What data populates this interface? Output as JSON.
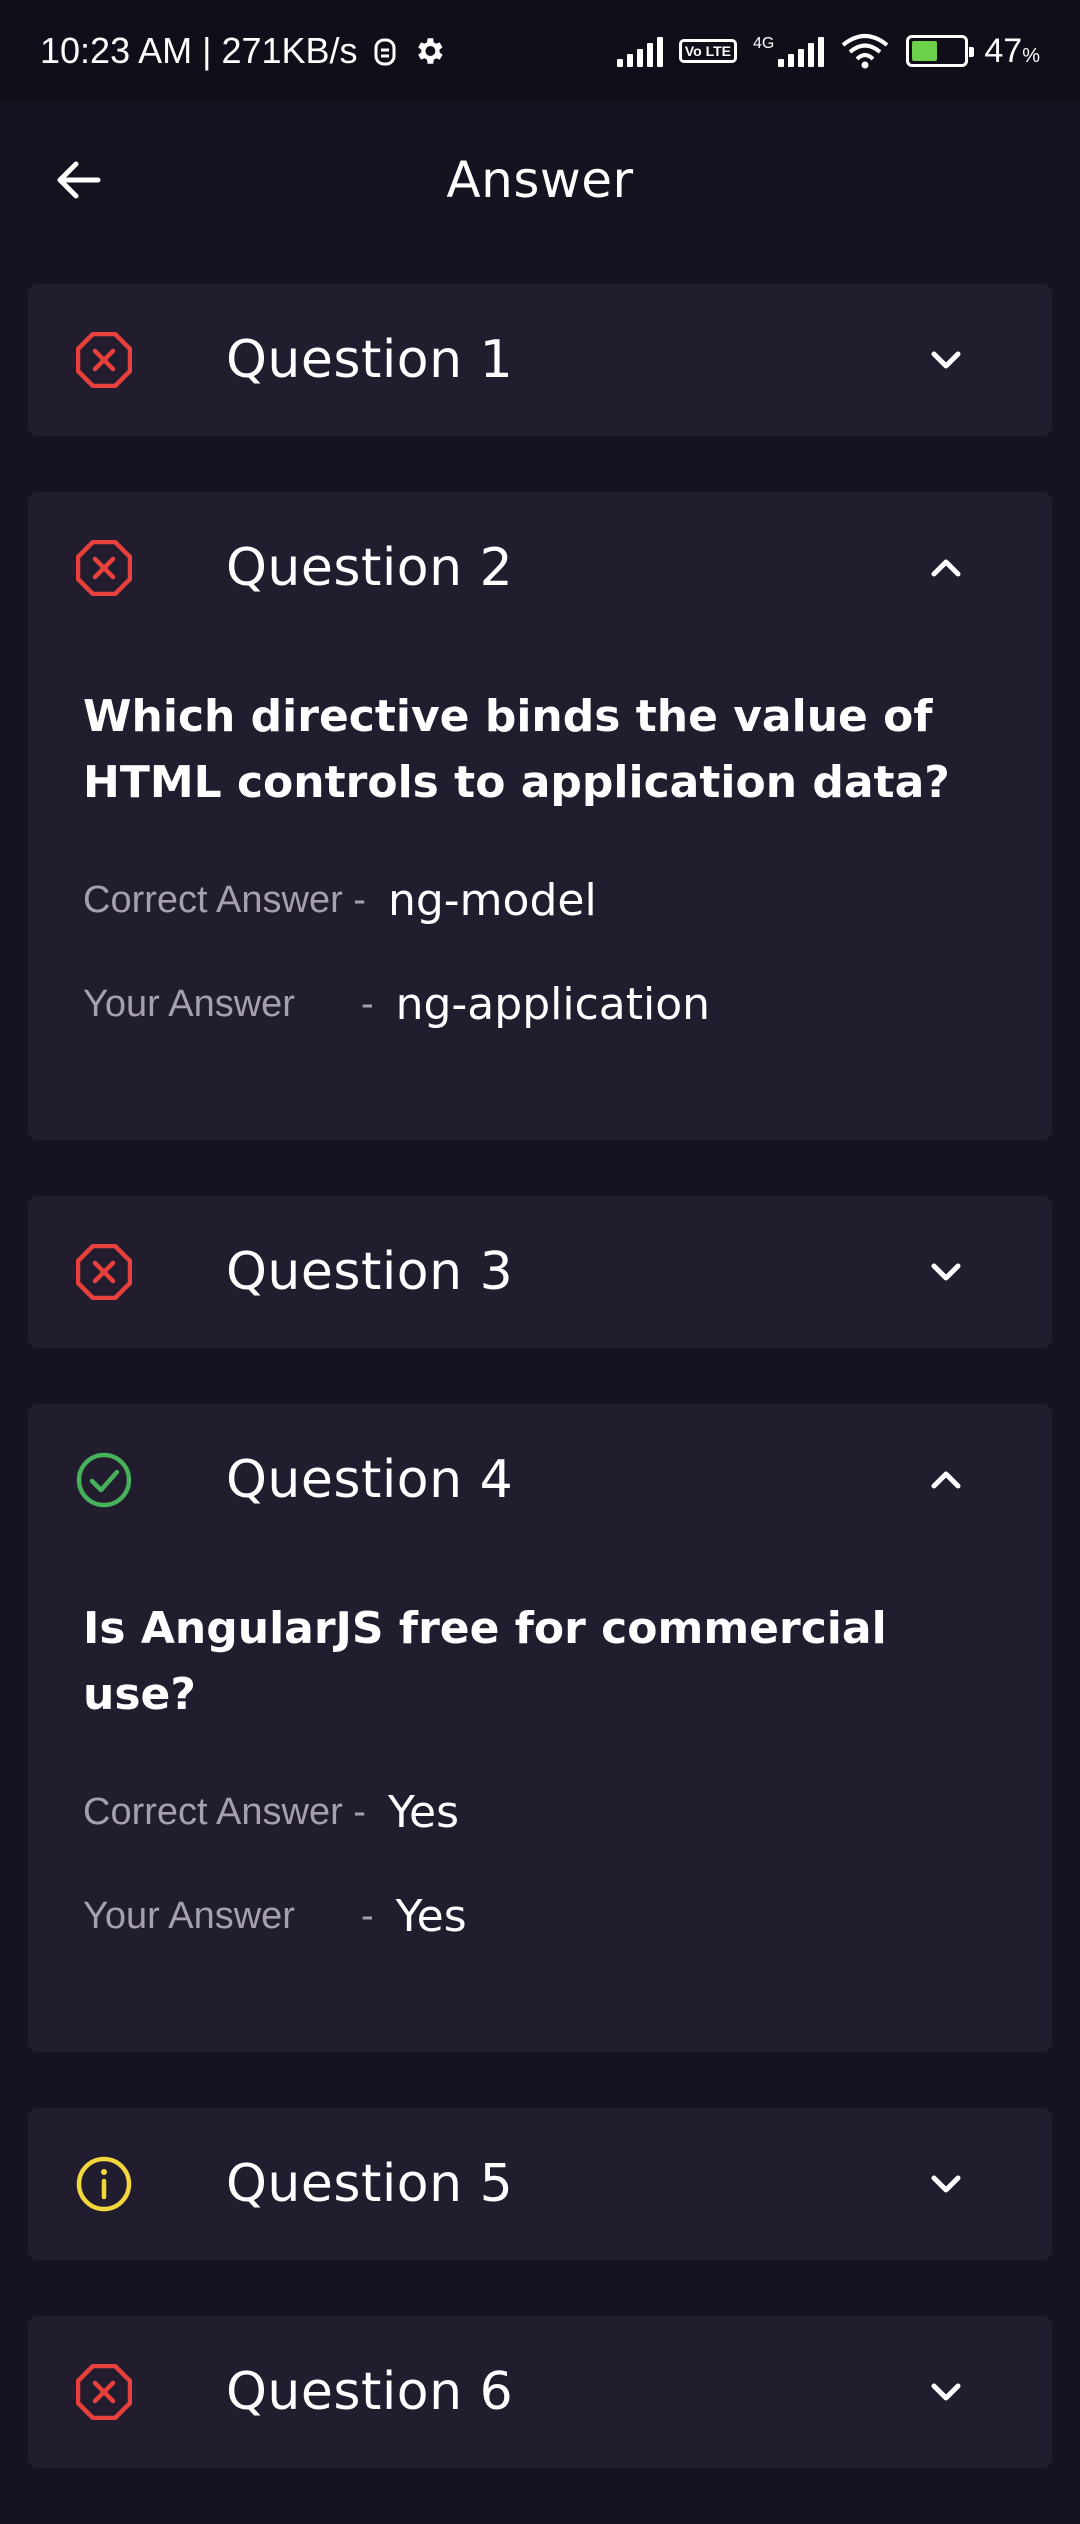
{
  "status_bar": {
    "time_speed": "10:23 AM | 271KB/s",
    "volte": "Vo LTE",
    "network": "4G",
    "battery_percent": "47",
    "battery_unit": "%",
    "battery_level": 0.47
  },
  "app_bar": {
    "title": "Answer"
  },
  "labels": {
    "correct_answer": "Correct Answer -",
    "your_answer": "Your Answer",
    "dash": "-"
  },
  "questions": [
    {
      "label": "Question 1",
      "status": "wrong"
    },
    {
      "label": "Question 2",
      "status": "wrong",
      "expanded": true,
      "text": "Which directive binds the value of HTML controls to application data?",
      "correct_answer": "ng-model",
      "your_answer": "ng-application"
    },
    {
      "label": "Question 3",
      "status": "wrong"
    },
    {
      "label": "Question 4",
      "status": "correct",
      "expanded": true,
      "text": "Is AngularJS free for commercial use?",
      "correct_answer": "Yes",
      "your_answer": "Yes"
    },
    {
      "label": "Question 5",
      "status": "skipped"
    },
    {
      "label": "Question 6",
      "status": "wrong"
    }
  ],
  "colors": {
    "wrong": "#e8413b",
    "correct": "#47b05a",
    "skipped": "#f2d83a",
    "card_bg": "#221c2f",
    "page_bg": "#17121f"
  }
}
